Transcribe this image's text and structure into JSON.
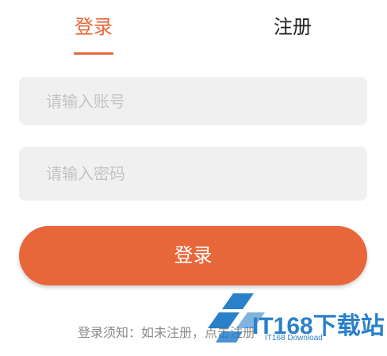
{
  "tabs": {
    "login_label": "登录",
    "register_label": "注册",
    "active": "login"
  },
  "form": {
    "account_placeholder": "请输入账号",
    "account_value": "",
    "password_placeholder": "请输入密码",
    "password_value": "",
    "submit_label": "登录"
  },
  "notice": {
    "prefix": "登录须知：如未注册，",
    "link": "点击注册"
  },
  "watermark": {
    "title": "IT168下载站",
    "subtitle": "IT168 Download"
  },
  "colors": {
    "accent": "#e8673a",
    "field_bg": "#f0f0f0",
    "watermark": "#1976c5"
  }
}
